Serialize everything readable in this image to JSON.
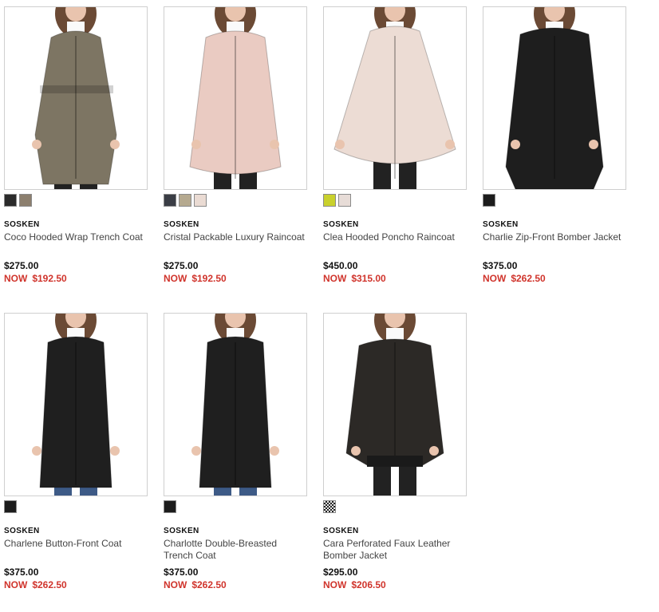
{
  "products": [
    {
      "brand": "SOSKEN",
      "name": "Coco Hooded Wrap Trench Coat",
      "price": "$275.00",
      "sale_label": "NOW",
      "sale_price": "$192.50",
      "swatches": [
        "#2b2b2b",
        "#8c7f6e"
      ],
      "coat_color": "#7d7563",
      "coat_style": "trench-belted"
    },
    {
      "brand": "SOSKEN",
      "name": "Cristal Packable Luxury Raincoat",
      "price": "$275.00",
      "sale_label": "NOW",
      "sale_price": "$192.50",
      "swatches": [
        "#3a3d45",
        "#b5a98f",
        "#eadbd3"
      ],
      "coat_color": "#eacbc2",
      "coat_style": "parka"
    },
    {
      "brand": "SOSKEN",
      "name": "Clea Hooded Poncho Raincoat",
      "price": "$450.00",
      "sale_label": "NOW",
      "sale_price": "$315.00",
      "swatches": [
        "#c9d12d",
        "#e7dcd7"
      ],
      "coat_color": "#ecdcd4",
      "coat_style": "poncho"
    },
    {
      "brand": "SOSKEN",
      "name": "Charlie Zip-Front Bomber Jacket",
      "price": "$375.00",
      "sale_label": "NOW",
      "sale_price": "$262.50",
      "swatches": [
        "#1c1c1c"
      ],
      "coat_color": "#1e1e1e",
      "coat_style": "long-zip"
    },
    {
      "brand": "SOSKEN",
      "name": "Charlene Button-Front Coat",
      "price": "$375.00",
      "sale_label": "NOW",
      "sale_price": "$262.50",
      "swatches": [
        "#1c1c1c"
      ],
      "coat_color": "#1f1f1f",
      "coat_style": "long-coat"
    },
    {
      "brand": "SOSKEN",
      "name": "Charlotte Double-Breasted Trench Coat",
      "price": "$375.00",
      "sale_label": "NOW",
      "sale_price": "$262.50",
      "swatches": [
        "#1c1c1c"
      ],
      "coat_color": "#1f1f1f",
      "coat_style": "long-coat"
    },
    {
      "brand": "SOSKEN",
      "name": "Cara Perforated Faux Leather Bomber Jacket",
      "price": "$295.00",
      "sale_label": "NOW",
      "sale_price": "$206.50",
      "swatches": [
        "pattern-check"
      ],
      "coat_color": "#2c2926",
      "coat_style": "bomber"
    }
  ],
  "colors": {
    "sale_red": "#d0342c",
    "border": "#cfcfcf"
  }
}
